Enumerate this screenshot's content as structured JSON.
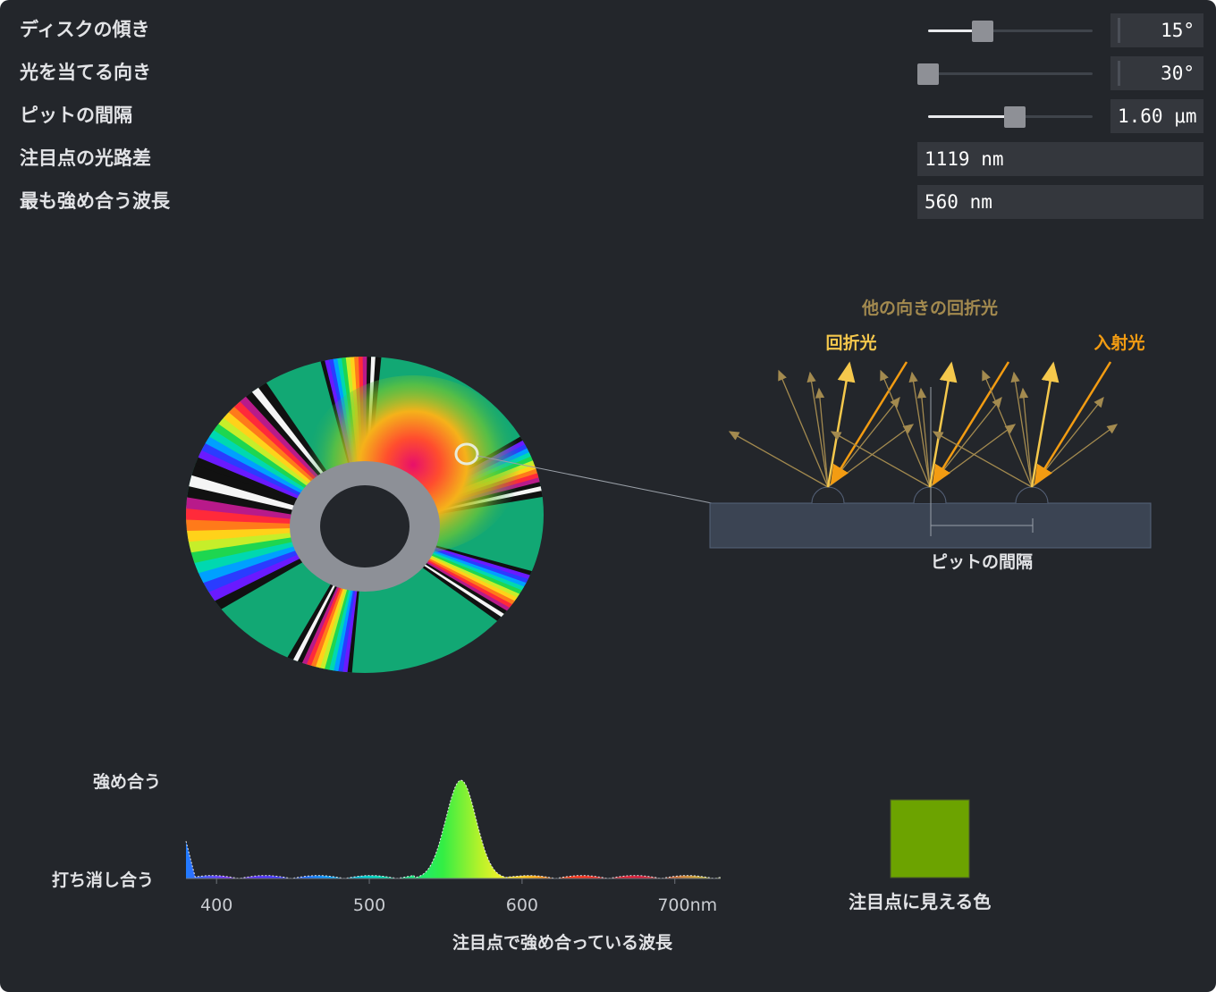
{
  "controls": [
    {
      "label": "ディスクの傾き",
      "value": "15°",
      "slider_fraction": 0.33,
      "editable": true
    },
    {
      "label": "光を当てる向き",
      "value": "30°",
      "slider_fraction": 0.0,
      "editable": true
    },
    {
      "label": "ピットの間隔",
      "value": "1.60 μm",
      "slider_fraction": 0.53,
      "editable": true
    },
    {
      "label": "注目点の光路差",
      "value": "1119 nm",
      "editable": false
    },
    {
      "label": "最も強め合う波長",
      "value": "560 nm",
      "editable": false
    }
  ],
  "diagram": {
    "other_diffracted_label": "他の向きの回折光",
    "diffracted_label": "回折光",
    "incident_label": "入射光",
    "pit_spacing_label": "ピットの間隔",
    "colors": {
      "diffracted": "#f5c84c",
      "incident": "#f39c12",
      "other": "#a38a4f",
      "substrate": "#3b4453"
    }
  },
  "spectrum": {
    "y_top_label": "強め合う",
    "y_bottom_label": "打ち消し合う",
    "x_ticks": [
      "400",
      "500",
      "600",
      "700nm"
    ],
    "x_caption": "注目点で強め合っている波長",
    "peak_nm": 560
  },
  "swatch": {
    "label": "注目点に見える色",
    "color": "#6ca300"
  },
  "chart_data": {
    "type": "area",
    "x_range": [
      380,
      730
    ],
    "peak": 560,
    "x_ticks": [
      400,
      500,
      600,
      700
    ],
    "x_unit": "nm"
  }
}
